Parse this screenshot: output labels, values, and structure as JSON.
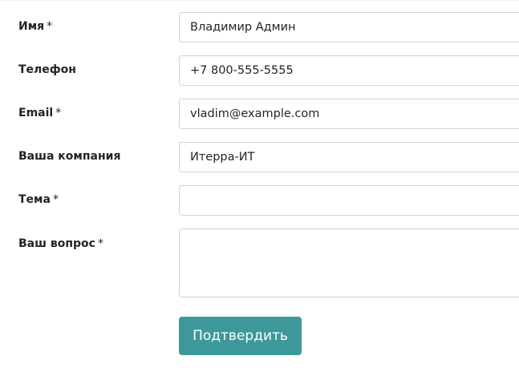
{
  "form": {
    "fields": [
      {
        "label": "Имя",
        "required_mark": "*",
        "value": "Владимир Админ",
        "placeholder": ""
      },
      {
        "label": "Телефон",
        "required_mark": "",
        "value": "+7 800-555-5555",
        "placeholder": ""
      },
      {
        "label": "Email",
        "required_mark": "*",
        "value": "vladim@example.com",
        "placeholder": ""
      },
      {
        "label": "Ваша компания",
        "required_mark": "",
        "value": "Итерра-ИТ",
        "placeholder": ""
      },
      {
        "label": "Тема",
        "required_mark": "*",
        "value": "",
        "placeholder": ""
      },
      {
        "label": "Ваш вопрос",
        "required_mark": "*",
        "value": "",
        "placeholder": ""
      }
    ],
    "submit_label": "Подтвердить"
  },
  "colors": {
    "submit_bg": "#3d9999",
    "field_border": "#ced4da",
    "text": "#212529"
  }
}
